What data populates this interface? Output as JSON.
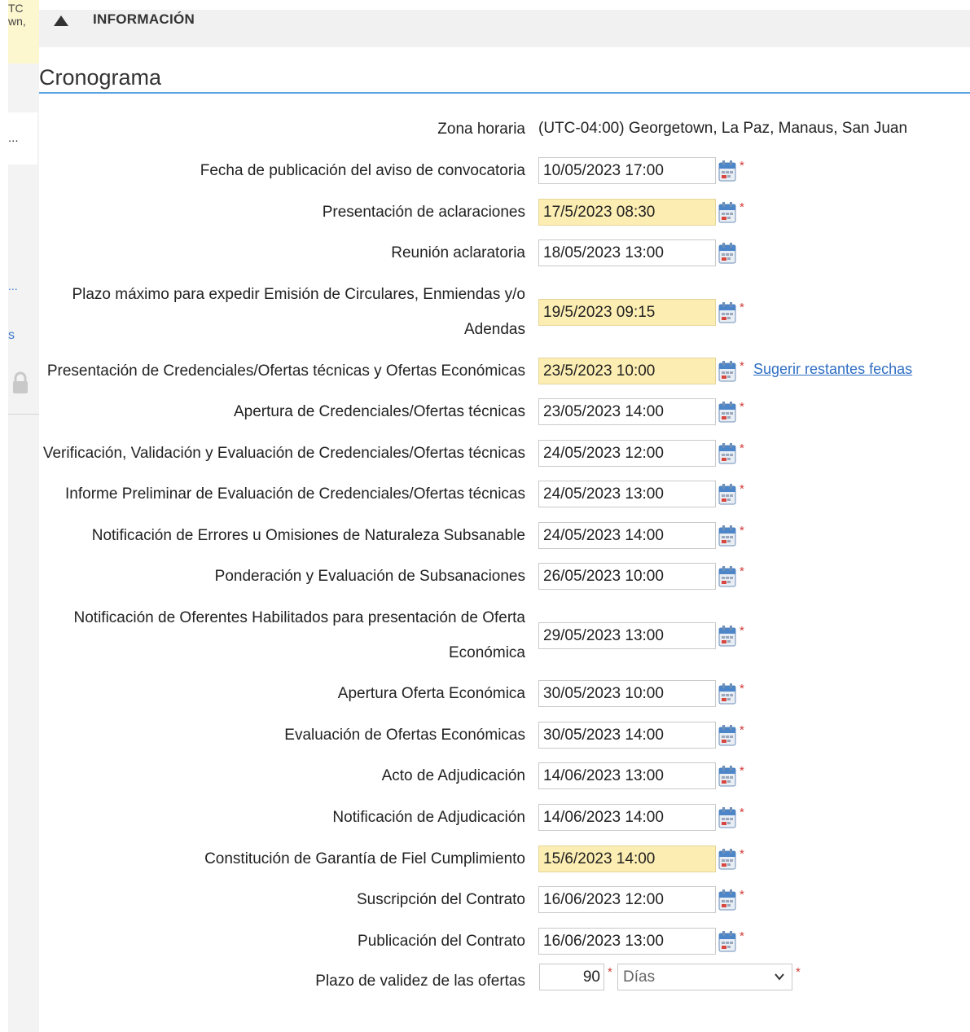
{
  "left_panel": {
    "top_lines": [
      "TC",
      "wn,"
    ],
    "tab_text": "...",
    "link_a": "...",
    "link_b": "s"
  },
  "section": {
    "title": "INFORMACIÓN"
  },
  "heading": "Cronograma",
  "timezone": {
    "label": "Zona horaria",
    "value": "(UTC-04:00) Georgetown, La Paz, Manaus, San Juan"
  },
  "schedule": [
    {
      "label": "Fecha de publicación del aviso de convocatoria",
      "value": "10/05/2023 17:00",
      "highlighted": false,
      "required": true
    },
    {
      "label": "Presentación de aclaraciones",
      "value": "17/5/2023 08:30",
      "highlighted": true,
      "required": true
    },
    {
      "label": "Reunión aclaratoria",
      "value": "18/05/2023 13:00",
      "highlighted": false,
      "required": false
    },
    {
      "label_lines": [
        "Plazo máximo para expedir Emisión de Circulares, Enmiendas y/o",
        "Adendas"
      ],
      "value": "19/5/2023 09:15",
      "highlighted": true,
      "required": true
    },
    {
      "label": "Presentación de Credenciales/Ofertas técnicas y Ofertas Económicas",
      "value": "23/5/2023 10:00",
      "highlighted": true,
      "required": true,
      "link": "Sugerir restantes fechas"
    },
    {
      "label": "Apertura de Credenciales/Ofertas técnicas",
      "value": "23/05/2023 14:00",
      "highlighted": false,
      "required": true
    },
    {
      "label": "Verificación, Validación y Evaluación de Credenciales/Ofertas técnicas",
      "value": "24/05/2023 12:00",
      "highlighted": false,
      "required": true
    },
    {
      "label": "Informe Preliminar de Evaluación de Credenciales/Ofertas técnicas",
      "value": "24/05/2023 13:00",
      "highlighted": false,
      "required": true
    },
    {
      "label": "Notificación de Errores u Omisiones de Naturaleza Subsanable",
      "value": "24/05/2023 14:00",
      "highlighted": false,
      "required": true
    },
    {
      "label": "Ponderación y Evaluación de Subsanaciones",
      "value": "26/05/2023 10:00",
      "highlighted": false,
      "required": true
    },
    {
      "label_lines": [
        "Notificación de Oferentes Habilitados para presentación de Oferta",
        "Económica"
      ],
      "value": "29/05/2023 13:00",
      "highlighted": false,
      "required": true
    },
    {
      "label": "Apertura Oferta Económica",
      "value": "30/05/2023 10:00",
      "highlighted": false,
      "required": true
    },
    {
      "label": "Evaluación de Ofertas Económicas",
      "value": "30/05/2023 14:00",
      "highlighted": false,
      "required": true
    },
    {
      "label": "Acto de Adjudicación",
      "value": "14/06/2023 13:00",
      "highlighted": false,
      "required": true
    },
    {
      "label": "Notificación de Adjudicación",
      "value": "14/06/2023 14:00",
      "highlighted": false,
      "required": true
    },
    {
      "label": "Constitución de Garantía de Fiel Cumplimiento",
      "value": "15/6/2023 14:00",
      "highlighted": true,
      "required": true
    },
    {
      "label": "Suscripción del Contrato",
      "value": "16/06/2023 12:00",
      "highlighted": false,
      "required": true
    },
    {
      "label": "Publicación del Contrato",
      "value": "16/06/2023 13:00",
      "highlighted": false,
      "required": true
    }
  ],
  "validity": {
    "label": "Plazo de validez de las ofertas",
    "value": "90",
    "unit": "Días"
  },
  "required_mark": "*",
  "colors": {
    "highlight": "#fcedb2",
    "accent": "#5aa2e0",
    "required": "#d43a3a",
    "link": "#2f6fc4"
  }
}
